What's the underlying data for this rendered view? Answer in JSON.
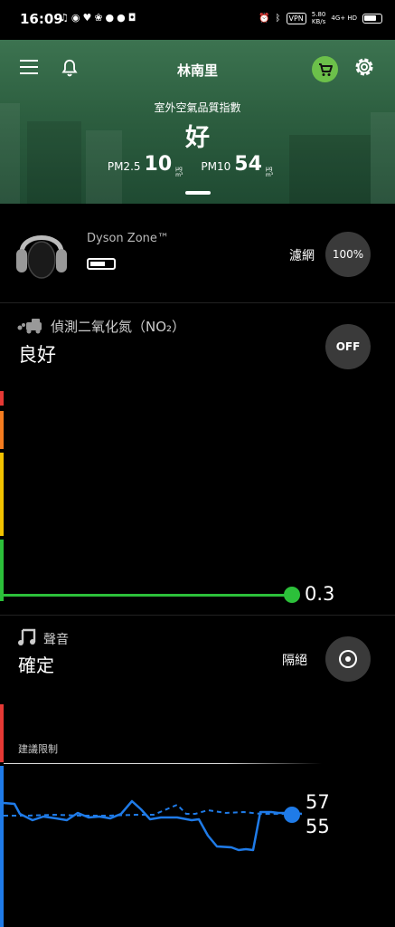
{
  "status_bar": {
    "time": "16:09",
    "vpn": "VPN",
    "net_speed": "5.80",
    "net_unit": "KB/s",
    "signal": "4G+ HD"
  },
  "header": {
    "location": "林南里",
    "aq_label": "室外空氣品質指數",
    "aq_value": "好",
    "pm25_label": "PM2.5",
    "pm25_value": "10",
    "pm10_label": "PM10",
    "pm10_value": "54",
    "unit_top": "µg",
    "unit_bottom": "m³",
    "bg_color": "#2d5f40",
    "cart_color": "#6cc04a"
  },
  "device": {
    "name": "Dyson Zone™",
    "filter_label": "濾網",
    "filter_value": "100%"
  },
  "no2": {
    "title": "偵測二氧化氮（NO₂）",
    "status": "良好",
    "toggle": "OFF",
    "value": "0.3",
    "bands": [
      "#e53935",
      "#f57c1f",
      "#f2c200",
      "#2cc03a"
    ]
  },
  "sound": {
    "title": "聲音",
    "status": "確定",
    "mode_label": "隔絕",
    "limit_label": "建議限制",
    "value_current": "57",
    "value_average": "55",
    "bands": [
      "#e53935",
      "#1f7be8"
    ],
    "line_color": "#1f7be8"
  }
}
